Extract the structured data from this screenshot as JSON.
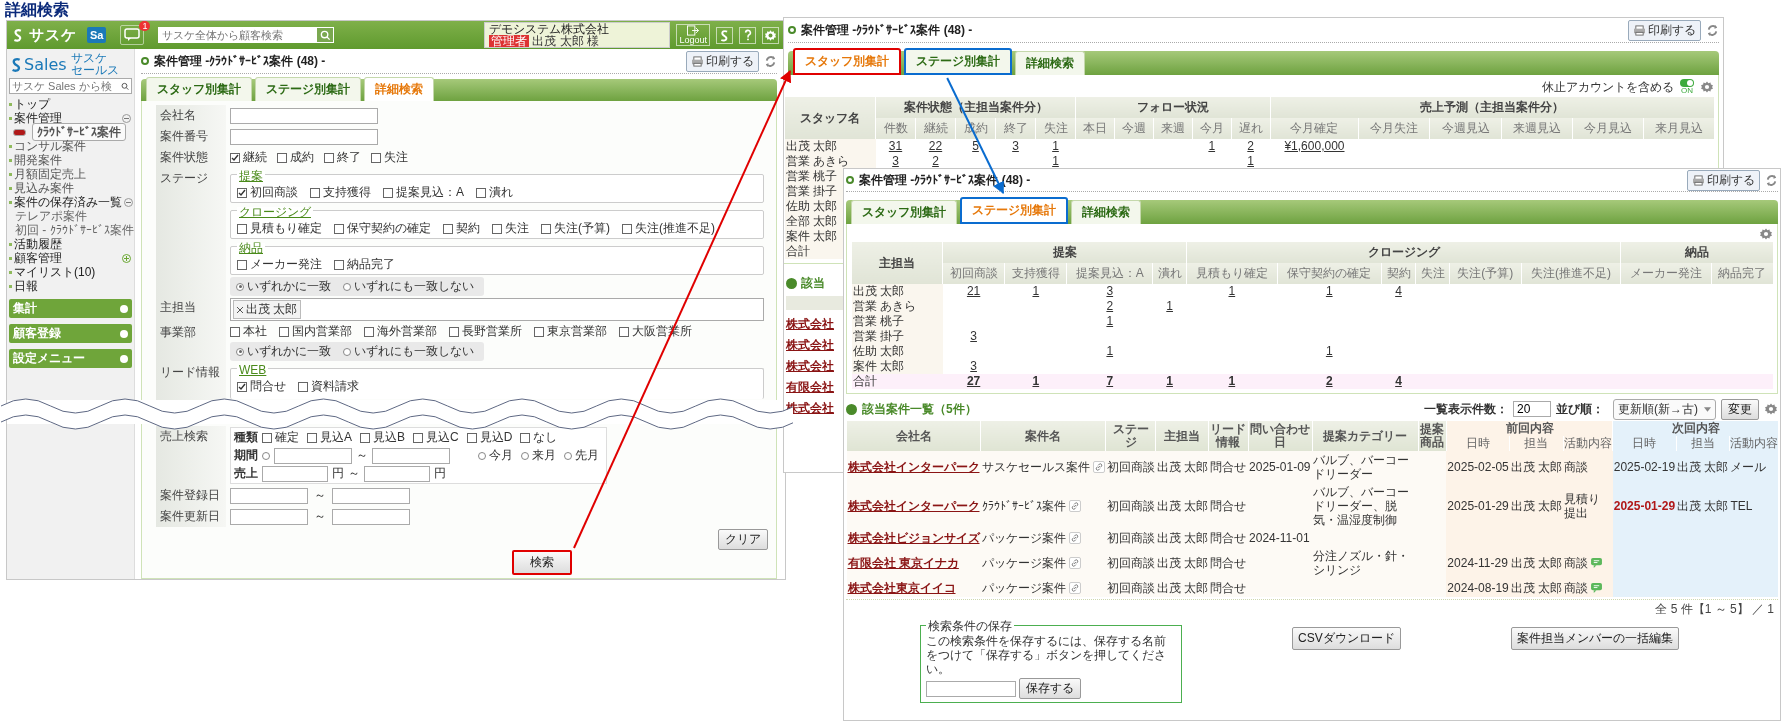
{
  "page_title": "詳細検索",
  "left_window": {
    "header": {
      "logo": "サスケ",
      "app_badge": "Sa",
      "notification_count": "1",
      "search_placeholder": "サスケ全体から顧客検索",
      "company": "デモシステム株式会社",
      "role": "管理者",
      "user": "出茂 太郎 様",
      "logout": "Logout"
    },
    "sidebar": {
      "logo": "Sales",
      "logo_sub": [
        "サスケ",
        "セールス"
      ],
      "search_placeholder": "サスケ Sales から検",
      "nav": [
        {
          "label": "トップ",
          "kind": "link"
        },
        {
          "label": "案件管理",
          "kind": "group",
          "expanded": true,
          "children": [
            {
              "label": "ｸﾗｳﾄﾞｻｰﾋﾞｽ案件",
              "selected": true
            },
            {
              "label": "コンサル案件",
              "selected": false
            },
            {
              "label": "開発案件",
              "selected": false
            },
            {
              "label": "月額固定売上",
              "selected": false
            },
            {
              "label": "見込み案件",
              "selected": false
            }
          ]
        },
        {
          "label": "案件の保存済み一覧",
          "kind": "saved",
          "expanded": true,
          "children": [
            {
              "label": "テレアポ案件",
              "selected": false
            },
            {
              "label": "初回 - ｸﾗｳﾄﾞｻｰﾋﾞｽ案件",
              "selected": false
            }
          ]
        },
        {
          "label": "活動履歴",
          "kind": "link"
        },
        {
          "label": "顧客管理",
          "kind": "group",
          "expanded": false
        },
        {
          "label": "マイリスト(10)",
          "kind": "link"
        },
        {
          "label": "日報",
          "kind": "link"
        }
      ],
      "sections": [
        "集計",
        "顧客登録",
        "設定メニュー"
      ]
    },
    "main": {
      "title": "案件管理 -ｸﾗｳﾄﾞｻｰﾋﾞｽ案件 (48) -",
      "print_button": "印刷する",
      "tabs": [
        {
          "label": "スタッフ別集計",
          "selected": false
        },
        {
          "label": "ステージ別集計",
          "selected": false
        },
        {
          "label": "詳細検索",
          "selected": true
        }
      ],
      "text_fields": [
        {
          "label": "会社名"
        },
        {
          "label": "案件番号"
        }
      ],
      "case_status": {
        "label": "案件状態",
        "options": [
          {
            "label": "継続",
            "checked": true
          },
          {
            "label": "成約",
            "checked": false
          },
          {
            "label": "終了",
            "checked": false
          },
          {
            "label": "失注",
            "checked": false
          }
        ]
      },
      "stage": {
        "label": "ステージ",
        "groups": [
          {
            "title": "提案",
            "options": [
              {
                "label": "初回商談",
                "checked": true
              },
              {
                "label": "支持獲得",
                "checked": false
              },
              {
                "label": "提案見込：A",
                "checked": false
              },
              {
                "label": "潰れ",
                "checked": false
              }
            ]
          },
          {
            "title": "クロージング",
            "options": [
              {
                "label": "見積もり確定",
                "checked": false
              },
              {
                "label": "保守契約の確定",
                "checked": false
              },
              {
                "label": "契約",
                "checked": false
              },
              {
                "label": "失注",
                "checked": false
              },
              {
                "label": "失注(予算)",
                "checked": false
              },
              {
                "label": "失注(推進不足)",
                "checked": false
              }
            ]
          },
          {
            "title": "納品",
            "options": [
              {
                "label": "メーカー発注",
                "checked": false
              },
              {
                "label": "納品完了",
                "checked": false
              }
            ]
          }
        ],
        "match": [
          {
            "label": "いずれかに一致",
            "selected": true
          },
          {
            "label": "いずれにも一致しない",
            "selected": false
          }
        ]
      },
      "owner": {
        "label": "主担当",
        "tags": [
          "出茂 太郎"
        ]
      },
      "division": {
        "label": "事業部",
        "options": [
          {
            "label": "本社",
            "checked": false
          },
          {
            "label": "国内営業部",
            "checked": false
          },
          {
            "label": "海外営業部",
            "checked": false
          },
          {
            "label": "長野営業所",
            "checked": false
          },
          {
            "label": "東京営業部",
            "checked": false
          },
          {
            "label": "大阪営業所",
            "checked": false
          }
        ],
        "match": [
          {
            "label": "いずれかに一致",
            "selected": true
          },
          {
            "label": "いずれにも一致しない",
            "selected": false
          }
        ]
      },
      "lead": {
        "label": "リード情報",
        "groups": [
          {
            "title": "WEB",
            "options": [
              {
                "label": "問合せ",
                "checked": true
              },
              {
                "label": "資料請求",
                "checked": false
              }
            ]
          }
        ]
      },
      "sales": {
        "label": "売上検索",
        "type_label": "種類",
        "types": [
          {
            "label": "確定",
            "checked": false
          },
          {
            "label": "見込A",
            "checked": false
          },
          {
            "label": "見込B",
            "checked": false
          },
          {
            "label": "見込C",
            "checked": false
          },
          {
            "label": "見込D",
            "checked": false
          },
          {
            "label": "なし",
            "checked": false
          }
        ],
        "period_label": "期間",
        "period_selected": false,
        "period_sep": "～",
        "presets": [
          {
            "label": "今月",
            "selected": false
          },
          {
            "label": "来月",
            "selected": false
          },
          {
            "label": "先月",
            "selected": false
          }
        ],
        "amount_label": "売上",
        "amount_unit_from": "円",
        "amount_sep": "～",
        "amount_unit_to": "円"
      },
      "dates": [
        {
          "label": "案件登録日",
          "sep": "～"
        },
        {
          "label": "案件更新日",
          "sep": "～"
        }
      ],
      "clear_button": "クリア",
      "search_button": {
        "label": "検索",
        "highlight": {
          "color": "#e00000"
        }
      }
    }
  },
  "back_window": {
    "title": "案件管理 -ｸﾗｳﾄﾞｻｰﾋﾞｽ案件 (48) -",
    "print_button": "印刷する",
    "tabs": [
      {
        "label": "スタッフ別集計",
        "selected": true,
        "highlight": {
          "color": "#e00000"
        }
      },
      {
        "label": "ステージ別集計",
        "selected": false,
        "highlight": {
          "color": "#0a6ccf"
        }
      },
      {
        "label": "詳細検索",
        "selected": false
      }
    ],
    "toggle": {
      "label": "休止アカウントを含める",
      "on": true,
      "state_text": "ON"
    },
    "table": {
      "name_header": "スタッフ名",
      "groups": [
        {
          "label": "案件状態（主担当案件分）",
          "columns": [
            "件数",
            "継続",
            "成約",
            "終了",
            "失注"
          ]
        },
        {
          "label": "フォロー状況",
          "columns": [
            "本日",
            "今週",
            "来週",
            "今月",
            "遅れ"
          ]
        },
        {
          "label": "売上予測（主担当案件分）",
          "columns": [
            "今月確定",
            "今月失注",
            "今週見込",
            "来週見込",
            "今月見込",
            "来月見込"
          ]
        }
      ],
      "rows": [
        {
          "name": "出茂 太郎",
          "cells": [
            "31",
            "22",
            "5",
            "3",
            "1",
            null,
            null,
            null,
            "1",
            "2",
            "¥1,600,000",
            null,
            null,
            null,
            null,
            null
          ]
        },
        {
          "name": "営業 あきら",
          "cells": [
            "3",
            "2",
            null,
            null,
            "1",
            null,
            null,
            null,
            null,
            "1",
            null,
            null,
            null,
            null,
            null,
            null
          ]
        }
      ],
      "more_names": [
        "営業 桃子",
        "営業 掛子",
        "佐助 太郎",
        "全部 太郎",
        "案件 太郎",
        "合計"
      ]
    },
    "list_title": "該当",
    "list_companies": [
      "株式会社",
      "株式会社",
      "株式会社",
      "有限会社",
      "株式会社"
    ]
  },
  "front_window": {
    "title": "案件管理 -ｸﾗｳﾄﾞｻｰﾋﾞｽ案件 (48) -",
    "print_button": "印刷する",
    "tabs": [
      {
        "label": "スタッフ別集計",
        "selected": false
      },
      {
        "label": "ステージ別集計",
        "selected": true,
        "highlight": {
          "color": "#0a6ccf"
        }
      },
      {
        "label": "詳細検索",
        "selected": false
      }
    ],
    "stage_table": {
      "name_header": "主担当",
      "groups": [
        {
          "label": "提案",
          "columns": [
            "初回商談",
            "支持獲得",
            "提案見込：A",
            "潰れ"
          ]
        },
        {
          "label": "クロージング",
          "columns": [
            "見積もり確定",
            "保守契約の確定",
            "契約",
            "失注",
            "失注(予算)",
            "失注(推進不足)"
          ]
        },
        {
          "label": "納品",
          "columns": [
            "メーカー発注",
            "納品完了"
          ]
        }
      ],
      "rows": [
        {
          "name": "出茂 太郎",
          "kind": "staff",
          "cells": [
            "21",
            "1",
            "3",
            null,
            "1",
            "1",
            "4",
            null,
            null,
            null,
            null,
            null
          ]
        },
        {
          "name": "営業 あきら",
          "kind": "staff",
          "cells": [
            null,
            null,
            "2",
            "1",
            null,
            null,
            null,
            null,
            null,
            null,
            null,
            null
          ]
        },
        {
          "name": "営業 桃子",
          "kind": "staff",
          "cells": [
            null,
            null,
            "1",
            null,
            null,
            null,
            null,
            null,
            null,
            null,
            null,
            null
          ]
        },
        {
          "name": "営業 掛子",
          "kind": "staff",
          "cells": [
            "3",
            null,
            null,
            null,
            null,
            null,
            null,
            null,
            null,
            null,
            null,
            null
          ]
        },
        {
          "name": "佐助 太郎",
          "kind": "staff",
          "cells": [
            null,
            null,
            "1",
            null,
            null,
            "1",
            null,
            null,
            null,
            null,
            null,
            null
          ]
        },
        {
          "name": "案件 太郎",
          "kind": "staff",
          "cells": [
            "3",
            null,
            null,
            null,
            null,
            null,
            null,
            null,
            null,
            null,
            null,
            null
          ]
        },
        {
          "name": "合計",
          "kind": "total",
          "cells": [
            "27",
            "1",
            "7",
            "1",
            "1",
            "2",
            "4",
            null,
            null,
            null,
            null,
            null
          ]
        }
      ]
    },
    "results": {
      "title": "該当案件一覧（5件）",
      "per_page_label": "一覧表示件数：",
      "per_page": "20",
      "sort_label": "並び順：",
      "sort_value": "更新順(新→古)",
      "change_button": "変更",
      "columns": [
        "会社名",
        "案件名",
        "ステージ",
        "主担当",
        "リード情報",
        "問い合わせ日",
        "提案カテゴリー",
        "提案商品"
      ],
      "prev_group": {
        "label": "前回内容",
        "columns": [
          "日時",
          "担当",
          "活動内容"
        ]
      },
      "next_group": {
        "label": "次回内容",
        "columns": [
          "日時",
          "担当",
          "活動内容"
        ]
      },
      "rows": [
        {
          "company": "株式会社インターパーク",
          "case": "サスケセールス案件",
          "stage": "初回商談",
          "owner": "出茂 太郎",
          "lead": "問合せ",
          "inquiry_date": "2025-01-09",
          "category": "バルブ、バーコードリーダー",
          "prev": {
            "date": "2025-02-05",
            "owner": "出茂 太郎",
            "activity": "商談",
            "memo": false
          },
          "next": {
            "date": "2025-02-19",
            "owner": "出茂 太郎",
            "activity": "メール",
            "overdue": false
          }
        },
        {
          "company": "株式会社インターパーク",
          "case": "ｸﾗｳﾄﾞｻｰﾋﾞｽ案件",
          "stage": "初回商談",
          "owner": "出茂 太郎",
          "lead": "問合せ",
          "inquiry_date": null,
          "category": "バルブ、バーコードリーダー、脱気・温湿度制御",
          "prev": {
            "date": "2025-01-29",
            "owner": "出茂 太郎",
            "activity": "見積り提出",
            "memo": false
          },
          "next": {
            "date": "2025-01-29",
            "owner": "出茂 太郎",
            "activity": "TEL",
            "overdue": true
          }
        },
        {
          "company": "株式会社ビジョンサイズ",
          "case": "パッケージ案件",
          "stage": "初回商談",
          "owner": "出茂 太郎",
          "lead": "問合せ",
          "inquiry_date": "2024-11-01",
          "category": null,
          "prev": null,
          "next": null
        },
        {
          "company": "有限会社 東京イナカ",
          "case": "パッケージ案件",
          "stage": "初回商談",
          "owner": "出茂 太郎",
          "lead": "問合せ",
          "inquiry_date": null,
          "category": "分注ノズル・針・シリンジ",
          "prev": {
            "date": "2024-11-29",
            "owner": "出茂 太郎",
            "activity": "商談",
            "memo": true
          },
          "next": null
        },
        {
          "company": "株式会社東京イイコ",
          "case": "パッケージ案件",
          "stage": "初回商談",
          "owner": "出茂 太郎",
          "lead": "問合せ",
          "inquiry_date": null,
          "category": null,
          "prev": {
            "date": "2024-08-19",
            "owner": "出茂 太郎",
            "activity": "商談",
            "memo": true
          },
          "next": null
        }
      ],
      "pagination": "全 5 件【1 ～ 5】 ／ 1"
    },
    "save_box": {
      "title": "検索条件の保存",
      "text": "この検索条件を保存するには、保存する名前をつけて「保存する」ボタンを押してください。",
      "button": "保存する"
    },
    "csv_button": "CSVダウンロード",
    "bulk_button": "案件担当メンバーの一括編集"
  }
}
